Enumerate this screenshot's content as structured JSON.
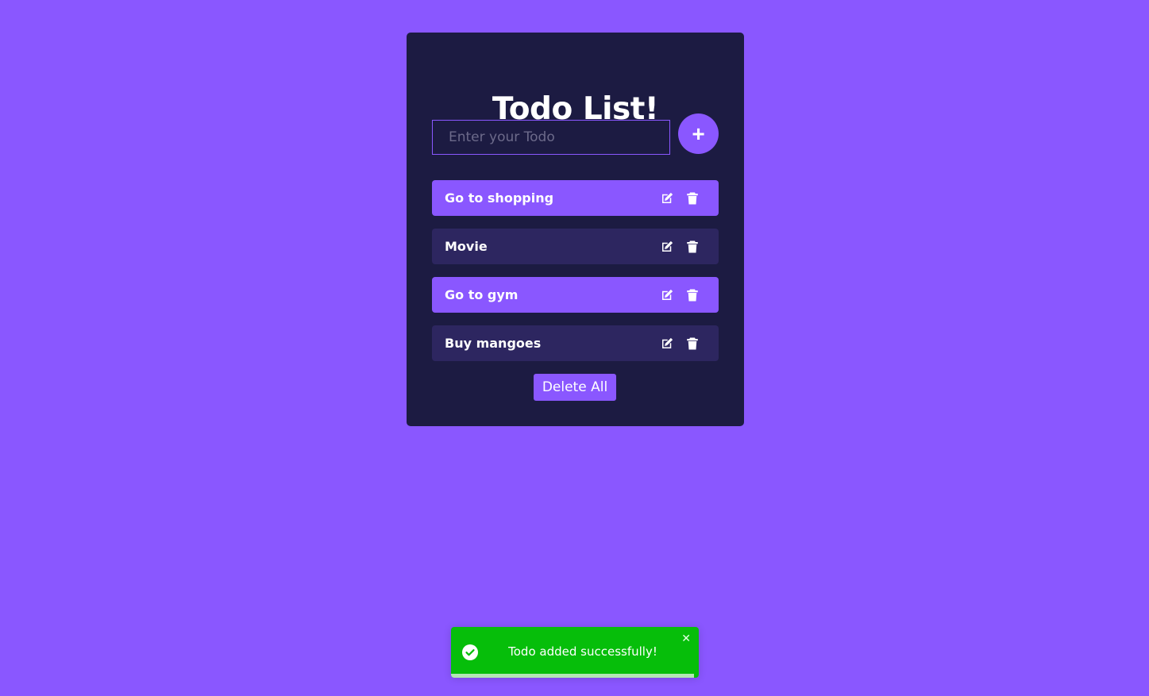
{
  "app": {
    "title": "Todo List!",
    "input": {
      "value": "",
      "placeholder": "Enter your Todo"
    },
    "add_button_label": "+",
    "todos": [
      {
        "text": "Go to shopping",
        "style": "purple",
        "edit_icon": "edit-icon",
        "delete_icon": "trash-icon"
      },
      {
        "text": "Movie",
        "style": "dark",
        "edit_icon": "edit-icon",
        "delete_icon": "trash-icon"
      },
      {
        "text": "Go to gym",
        "style": "purple",
        "edit_icon": "edit-icon",
        "delete_icon": "trash-icon"
      },
      {
        "text": "Buy mangoes",
        "style": "dark",
        "edit_icon": "edit-icon",
        "delete_icon": "trash-icon"
      }
    ],
    "delete_all_label": "Delete All"
  },
  "toast": {
    "icon": "check-circle-icon",
    "message": "Todo added successfully!",
    "close_label": "✕",
    "progress_percent": 98
  },
  "colors": {
    "background": "#8a57ff",
    "card": "#1c1b42",
    "accent": "#8a57ff",
    "item_dark": "#2d2660",
    "toast_success": "#06be0a"
  }
}
